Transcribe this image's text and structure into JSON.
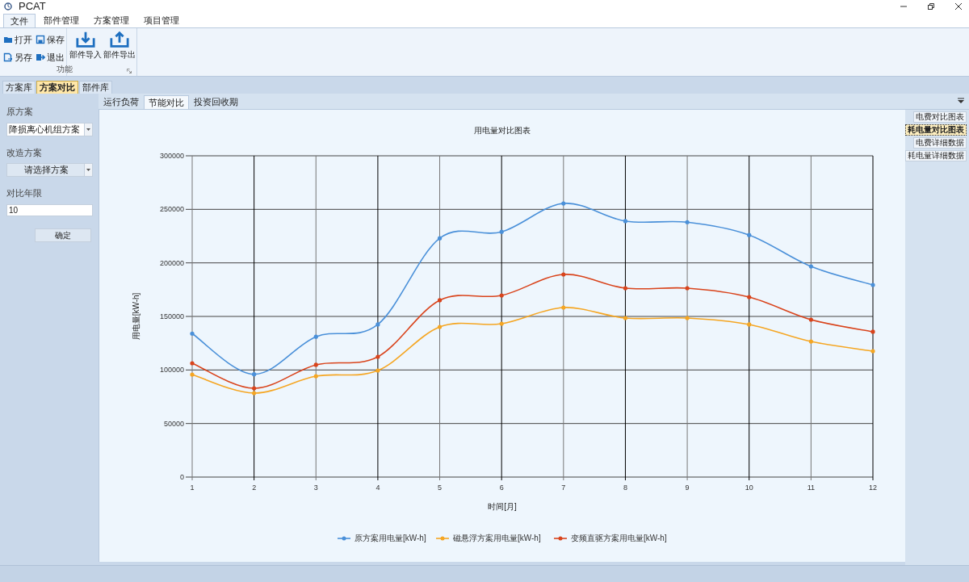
{
  "window": {
    "title": "PCAT"
  },
  "ribbon_tabs": [
    {
      "label": "文件",
      "selected": true
    },
    {
      "label": "部件管理",
      "selected": false
    },
    {
      "label": "方案管理",
      "selected": false
    },
    {
      "label": "项目管理",
      "selected": false
    }
  ],
  "ribbon_group": {
    "label": "功能",
    "small_buttons": [
      {
        "label": "打开",
        "kind": "open"
      },
      {
        "label": "保存",
        "kind": "save"
      },
      {
        "label": "另存",
        "kind": "saveas"
      },
      {
        "label": "退出",
        "kind": "exit"
      }
    ],
    "large_buttons": [
      {
        "label": "部件导入",
        "kind": "import"
      },
      {
        "label": "部件导出",
        "kind": "export"
      }
    ]
  },
  "side_tabs": [
    {
      "label": "方案库",
      "selected": false
    },
    {
      "label": "方案对比",
      "selected": true
    },
    {
      "label": "部件库",
      "selected": false
    }
  ],
  "left_panel": {
    "original_label": "原方案",
    "original_value": "降损离心机组方案",
    "retrofit_label": "改造方案",
    "retrofit_value": "请选择方案",
    "years_label": "对比年限",
    "years_value": "10",
    "confirm_button": "确定"
  },
  "content_tabs": [
    {
      "label": "运行负荷",
      "selected": false
    },
    {
      "label": "节能对比",
      "selected": true
    },
    {
      "label": "投资回收期",
      "selected": false
    }
  ],
  "chart": {
    "chart_data": {
      "type": "line",
      "grid": true,
      "legend": true,
      "title": "用电量对比图表",
      "xlabel": "时间[月]",
      "ylabel": "用电量[kW-h]",
      "categories": [
        "1",
        "2",
        "3",
        "4",
        "5",
        "6",
        "7",
        "8",
        "9",
        "10",
        "11",
        "12"
      ],
      "ylim": [
        0,
        300000
      ],
      "yticks": [
        0,
        50000,
        100000,
        150000,
        200000,
        250000,
        300000
      ],
      "series": [
        {
          "name": "原方案用电量[kW-h]",
          "color": "#4a90d9",
          "values": [
            134000,
            96000,
            131000,
            142500,
            223000,
            229000,
            255500,
            239000,
            238000,
            226000,
            196700,
            179400
          ]
        },
        {
          "name": "磁悬浮方案用电量[kW-h]",
          "color": "#f5a623",
          "values": [
            95700,
            78400,
            94200,
            99500,
            140200,
            143200,
            158300,
            148500,
            148500,
            142500,
            126600,
            117600
          ]
        },
        {
          "name": "变频直驱方案用电量[kW-h]",
          "color": "#d9441c",
          "values": [
            106300,
            82900,
            104800,
            112300,
            165100,
            169600,
            189200,
            176400,
            176400,
            168100,
            147000,
            135700
          ]
        }
      ]
    }
  },
  "view_buttons": [
    {
      "label": "电费对比图表",
      "selected": false
    },
    {
      "label": "耗电量对比图表",
      "selected": true
    },
    {
      "label": "电费详细数据",
      "selected": false
    },
    {
      "label": "耗电量详细数据",
      "selected": false
    }
  ]
}
